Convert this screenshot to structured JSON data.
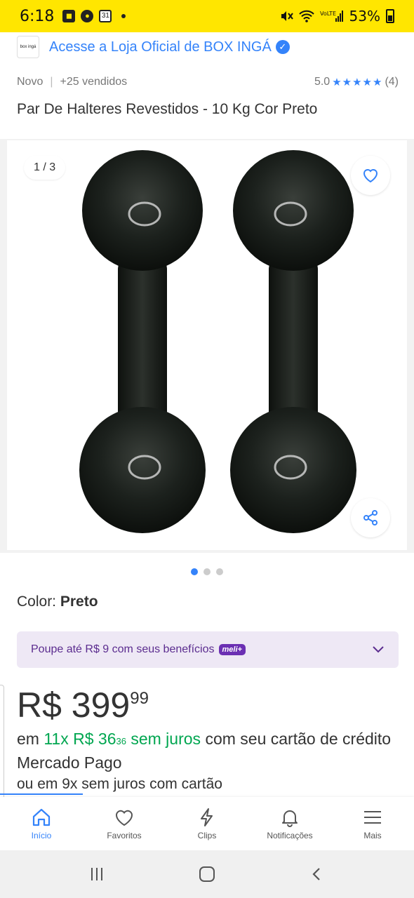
{
  "status_bar": {
    "time": "6:18",
    "calendar_day": "31",
    "battery_percent": "53%"
  },
  "store": {
    "logo_text": "box ingá",
    "link_text": "Acesse a Loja Oficial de BOX INGÁ"
  },
  "product": {
    "condition": "Novo",
    "sold": "+25 vendidos",
    "rating_value": "5.0",
    "rating_stars": 5,
    "rating_count": "(4)",
    "title": "Par De Halteres Revestidos - 10 Kg Cor Preto"
  },
  "gallery": {
    "counter": "1 / 3",
    "total_images": 3,
    "active_index": 0
  },
  "color": {
    "label": "Color:",
    "value": "Preto"
  },
  "promo": {
    "text": "Poupe até R$ 9 com seus benefícios",
    "badge": "meli+"
  },
  "price": {
    "currency_main": "R$ 399",
    "cents": "99",
    "installment_prefix": "em",
    "installment_green_1": "11x R$ 36",
    "installment_cents": "36",
    "installment_green_2": "sem juros",
    "installment_suffix": "com seu cartão de crédito Mercado Pago",
    "alt_installments": "ou em 9x sem juros com cartão"
  },
  "bottom_nav": {
    "items": [
      {
        "label": "Início",
        "icon": "home-icon"
      },
      {
        "label": "Favoritos",
        "icon": "heart-icon"
      },
      {
        "label": "Clips",
        "icon": "lightning-icon"
      },
      {
        "label": "Notificações",
        "icon": "bell-icon"
      },
      {
        "label": "Mais",
        "icon": "menu-icon"
      }
    ]
  },
  "colors": {
    "brand_yellow": "#FFE600",
    "link_blue": "#3483FA",
    "price_green": "#00A650",
    "promo_bg": "#EEE8F5",
    "promo_text": "#5B2C8F"
  }
}
